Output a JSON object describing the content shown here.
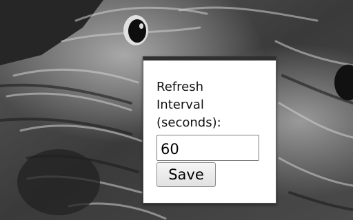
{
  "popup": {
    "label_lines": [
      "Refresh",
      "Interval",
      "(seconds):"
    ],
    "interval_value": "60",
    "save_label": "Save"
  },
  "colors": {
    "popup_background": "#ffffff",
    "popup_top_bar": "#303030",
    "backdrop_dark": "#2e2e2e",
    "backdrop_light": "#bdbdbd"
  }
}
